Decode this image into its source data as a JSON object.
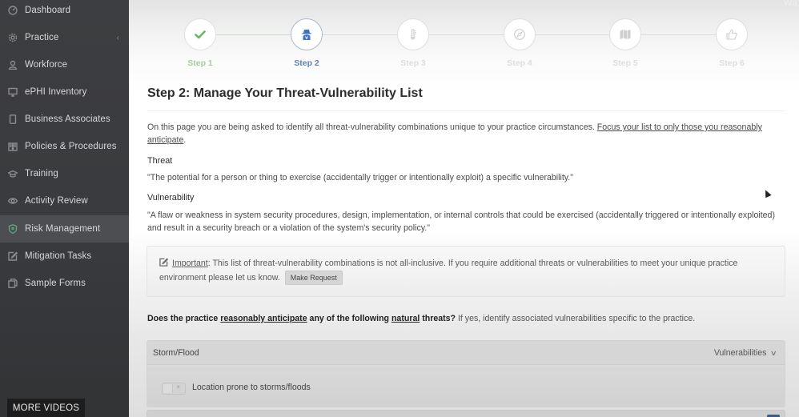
{
  "sidebar": {
    "items": [
      {
        "label": "Dashboard",
        "icon": "dashboard-gauge-icon"
      },
      {
        "label": "Practice",
        "icon": "gear-icon",
        "chevron": "‹"
      },
      {
        "label": "Workforce",
        "icon": "user-icon"
      },
      {
        "label": "ePHI Inventory",
        "icon": "monitor-icon"
      },
      {
        "label": "Business Associates",
        "icon": "tablet-icon"
      },
      {
        "label": "Policies & Procedures",
        "icon": "book-icon"
      },
      {
        "label": "Training",
        "icon": "graduation-cap-icon"
      },
      {
        "label": "Activity Review",
        "icon": "eye-icon"
      },
      {
        "label": "Risk Management",
        "icon": "shield-icon",
        "active": true
      },
      {
        "label": "Mitigation Tasks",
        "icon": "edit-icon"
      },
      {
        "label": "Sample Forms",
        "icon": "copy-icon"
      }
    ],
    "more_videos": "MORE VIDEOS"
  },
  "header": {
    "corner_text": "Wa"
  },
  "stepper": {
    "steps": [
      {
        "label": "Step 1",
        "state": "done",
        "icon": "check-icon"
      },
      {
        "label": "Step 2",
        "state": "active",
        "icon": "spy-icon"
      },
      {
        "label": "Step 3",
        "state": "pending",
        "icon": "thermometer-icon"
      },
      {
        "label": "Step 4",
        "state": "pending",
        "icon": "compass-icon"
      },
      {
        "label": "Step 5",
        "state": "pending",
        "icon": "map-icon"
      },
      {
        "label": "Step 6",
        "state": "pending",
        "icon": "thumbs-up-icon"
      }
    ],
    "colors": {
      "done": "#6fb562",
      "active": "#3d73c6",
      "pending": "#cfcfcf"
    }
  },
  "main": {
    "title": "Step 2: Manage Your Threat-Vulnerability List",
    "intro": "On this page you are being asked to identify all threat-vulnerability combinations unique to your practice circumstances.",
    "intro_link": "Focus your list to only those you reasonably anticipate",
    "intro_end": ".",
    "threat_label": "Threat",
    "threat_def": "\"The potential for a person or thing to exercise (accidentally trigger or intentionally exploit) a specific vulnerability.\"",
    "vuln_label": "Vulnerability",
    "vuln_def": "\"A flaw or weakness in system security procedures, design, implementation, or internal controls that could be exercised (accidentally triggered or intentionally exploited) and result in a security breach or a violation of the system's security policy.\"",
    "notice": {
      "important": "Important",
      "text": ": This list of threat-vulnerability combinations is not all-inclusive. If you require additional threats or vulnerabilities to meet your unique practice environment please let us know.",
      "button": "Make Request"
    },
    "question": {
      "p1": "Does the practice ",
      "u1": "reasonably anticipate",
      "p2": " any of the following ",
      "u2": "natural",
      "p3": " threats?",
      "rest": " If yes, identify associated vulnerabilities specific to the practice."
    },
    "threats": [
      {
        "name": "Storm/Flood",
        "toggle_label": "Vulnerabilities",
        "vulnerabilities": [
          {
            "label": "Location prone to storms/floods",
            "selected": false,
            "switch_mark": "×"
          }
        ]
      }
    ]
  }
}
